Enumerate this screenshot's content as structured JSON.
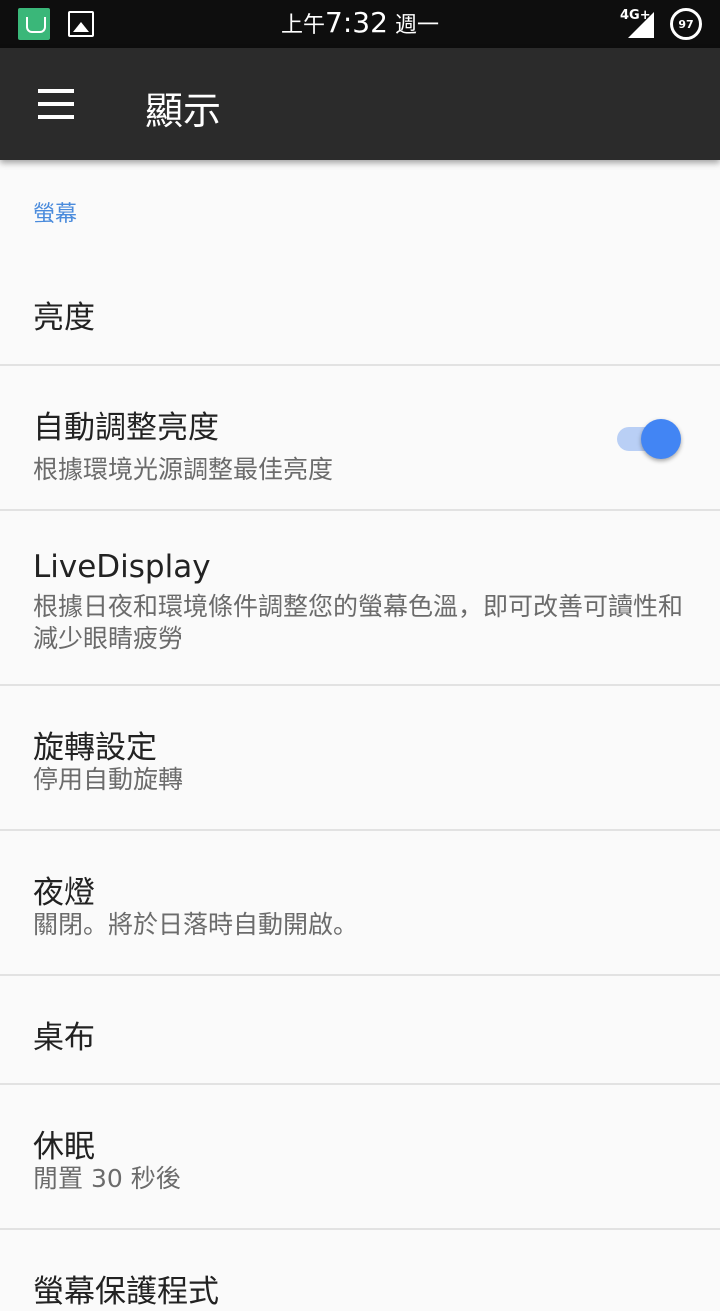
{
  "status_bar": {
    "time_prefix": "上午",
    "time": "7:32",
    "weekday": "週一",
    "network": "4G+",
    "battery": "97"
  },
  "app_bar": {
    "title": "顯示"
  },
  "section": {
    "label": "螢幕"
  },
  "items": [
    {
      "title": "亮度"
    },
    {
      "title": "自動調整亮度",
      "subtitle": "根據環境光源調整最佳亮度",
      "toggle_on": true
    },
    {
      "title": "LiveDisplay",
      "subtitle": "根據日夜和環境條件調整您的螢幕色溫，即可改善可讀性和減少眼睛疲勞"
    },
    {
      "title": "旋轉設定",
      "subtitle": "停用自動旋轉"
    },
    {
      "title": "夜燈",
      "subtitle": "關閉。將於日落時自動開啟。"
    },
    {
      "title": "桌布"
    },
    {
      "title": "休眠",
      "subtitle": "閒置 30 秒後"
    },
    {
      "title": "螢幕保護程式"
    }
  ],
  "colors": {
    "accent": "#4285f4",
    "section_header": "#4a8bdc",
    "app_bar": "#2b2b2b"
  }
}
